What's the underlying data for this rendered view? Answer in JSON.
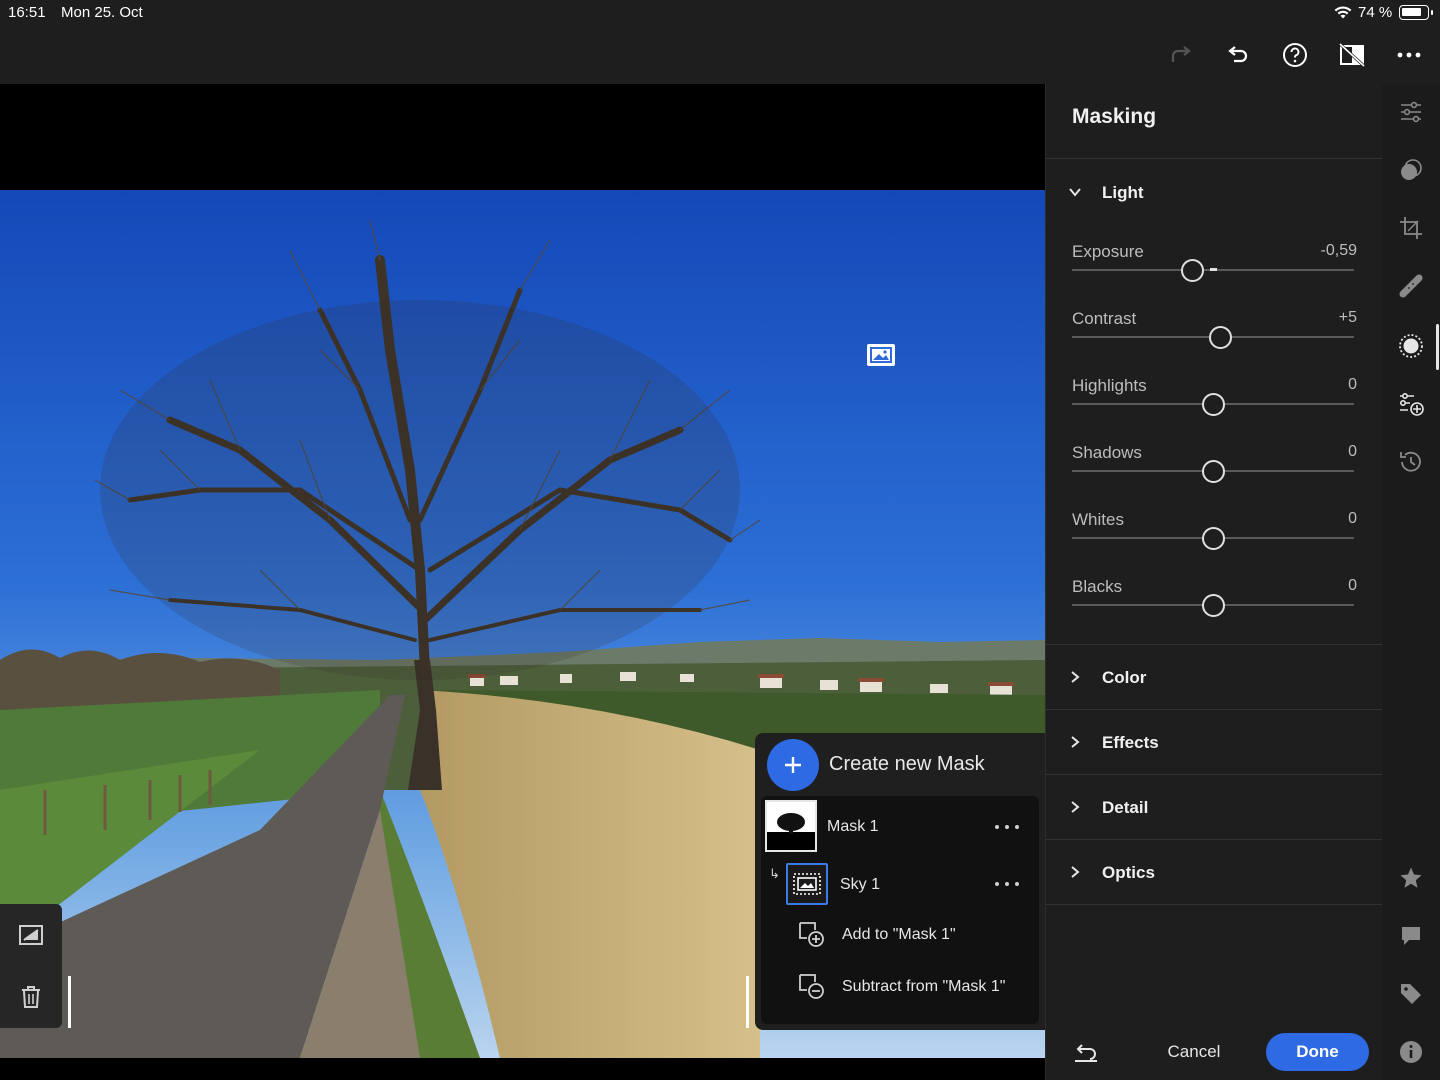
{
  "status": {
    "time": "16:51",
    "date": "Mon 25. Oct",
    "battery": "74 %",
    "battery_level": 0.74
  },
  "toolbar": {
    "icons": [
      "redo-icon",
      "undo-icon",
      "help-icon",
      "compare-off-icon",
      "more-icon"
    ]
  },
  "mask_panel": {
    "create_label": "Create new Mask",
    "masks": [
      {
        "name": "Mask 1"
      },
      {
        "name": "Sky 1"
      }
    ],
    "actions": [
      {
        "label": "Add to \"Mask 1\""
      },
      {
        "label": "Subtract from \"Mask 1\""
      }
    ]
  },
  "panel": {
    "title": "Masking",
    "sections": [
      {
        "label": "Light",
        "expanded": true
      },
      {
        "label": "Color",
        "expanded": false
      },
      {
        "label": "Effects",
        "expanded": false
      },
      {
        "label": "Detail",
        "expanded": false
      },
      {
        "label": "Optics",
        "expanded": false
      }
    ],
    "sliders": [
      {
        "label": "Exposure",
        "value": "-0,59",
        "num": -0.59,
        "min": -4,
        "max": 4
      },
      {
        "label": "Contrast",
        "value": "+5",
        "num": 5,
        "min": -100,
        "max": 100
      },
      {
        "label": "Highlights",
        "value": "0",
        "num": 0,
        "min": -100,
        "max": 100
      },
      {
        "label": "Shadows",
        "value": "0",
        "num": 0,
        "min": -100,
        "max": 100
      },
      {
        "label": "Whites",
        "value": "0",
        "num": 0,
        "min": -100,
        "max": 100
      },
      {
        "label": "Blacks",
        "value": "0",
        "num": 0,
        "min": -100,
        "max": 100
      }
    ],
    "cancel_label": "Cancel",
    "done_label": "Done"
  },
  "rail": {
    "icons": [
      "edit-sliders-icon",
      "mask-presets-icon",
      "crop-icon",
      "healing-icon",
      "masking-icon",
      "versions-icon",
      "history-icon",
      "rating-icon",
      "comment-icon",
      "tag-icon",
      "info-icon"
    ]
  },
  "colors": {
    "accent": "#2d6ae3",
    "panel_bg": "#1e1e1e"
  }
}
